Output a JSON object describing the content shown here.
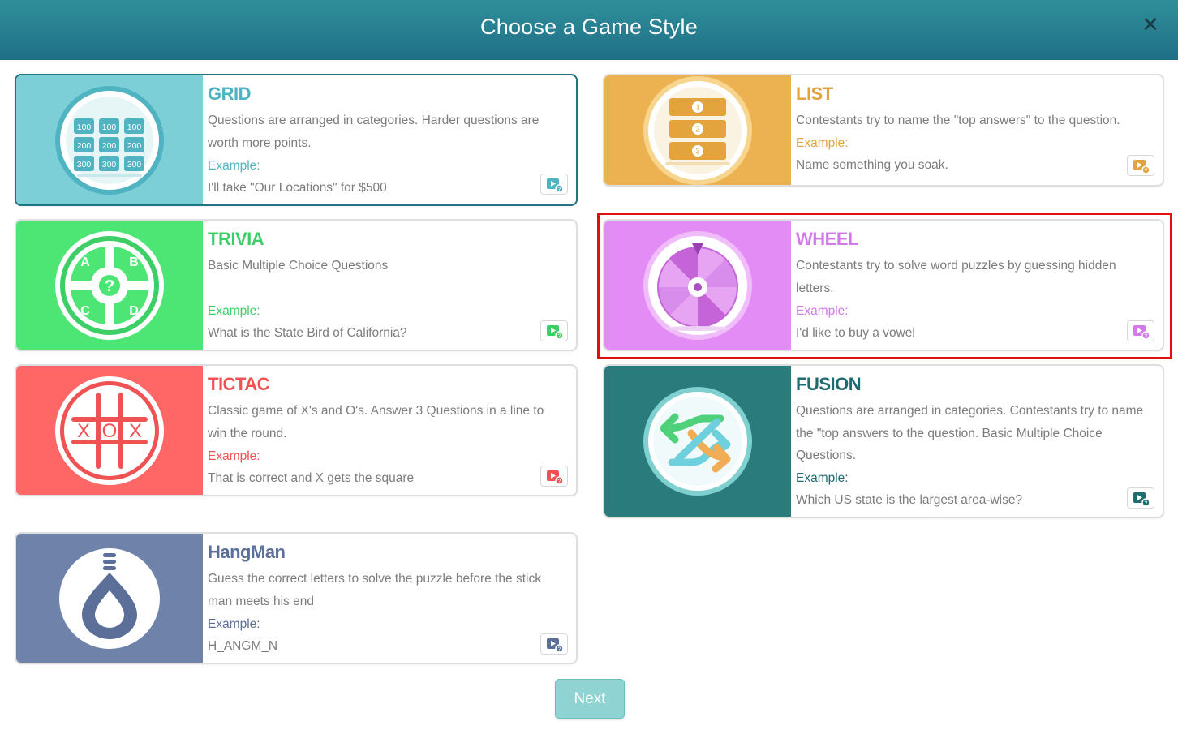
{
  "dialog": {
    "title": "Choose a Game Style",
    "close_label": "✕"
  },
  "styles": [
    {
      "id": "grid",
      "title": "GRID",
      "description": "Questions are arranged in categories. Harder questions are worth more points.",
      "example_label": "Example:",
      "example": "I'll take \"Our Locations\" for $500",
      "color": "#7ccfd6",
      "accent": "#4fb3c1",
      "icon": "grid-board-icon",
      "grid_values": [
        "100",
        "100",
        "100",
        "200",
        "200",
        "200",
        "300",
        "300",
        "300"
      ],
      "selected": true
    },
    {
      "id": "list",
      "title": "LIST",
      "description": "Contestants try to name the \"top answers\" to the question.",
      "example_label": "Example:",
      "example": "Name something you soak.",
      "color": "#ecb252",
      "accent": "#e3a33d",
      "icon": "numbered-list-icon",
      "list_numbers": [
        "1",
        "2",
        "3"
      ]
    },
    {
      "id": "trivia",
      "title": "TRIVIA",
      "description": "Basic Multiple Choice Questions",
      "example_label": "Example:",
      "example": "What is the State Bird of California?",
      "color": "#4de675",
      "accent": "#3dcf66",
      "icon": "multiple-choice-icon",
      "choices": [
        "A",
        "B",
        "C",
        "D"
      ],
      "center_mark": "?"
    },
    {
      "id": "wheel",
      "title": "WHEEL",
      "description": "Contestants try to solve word puzzles by guessing hidden letters.",
      "example_label": "Example:",
      "example": "I'd like to buy a vowel",
      "color": "#e38cf6",
      "accent": "#d27ae8",
      "icon": "prize-wheel-icon",
      "highlighted": true
    },
    {
      "id": "tictac",
      "title": "TICTAC",
      "description": "Classic game of X's and O's. Answer 3 Questions in a line to win the round.",
      "example_label": "Example:",
      "example": "That is correct and X gets the square",
      "color": "#ff6767",
      "accent": "#ef5252",
      "icon": "tic-tac-toe-icon",
      "marks": [
        "X",
        "O",
        "X"
      ]
    },
    {
      "id": "fusion",
      "title": "FUSION",
      "description": "Questions are arranged in categories. Contestants try to name the \"top answers to the question. Basic Multiple Choice Questions.",
      "example_label": "Example:",
      "example": "Which US state is the largest area-wise?",
      "color": "#2a7c7c",
      "accent": "#1f6b6f",
      "icon": "fusion-arrows-icon"
    },
    {
      "id": "hangman",
      "title": "HangMan",
      "description": "Guess the correct letters to solve the puzzle before the stick man meets his end",
      "example_label": "Example:",
      "example": "H_ANGM_N",
      "color": "#6e82aa",
      "accent": "#5b6f98",
      "icon": "noose-icon"
    }
  ],
  "footer": {
    "next_label": "Next"
  }
}
